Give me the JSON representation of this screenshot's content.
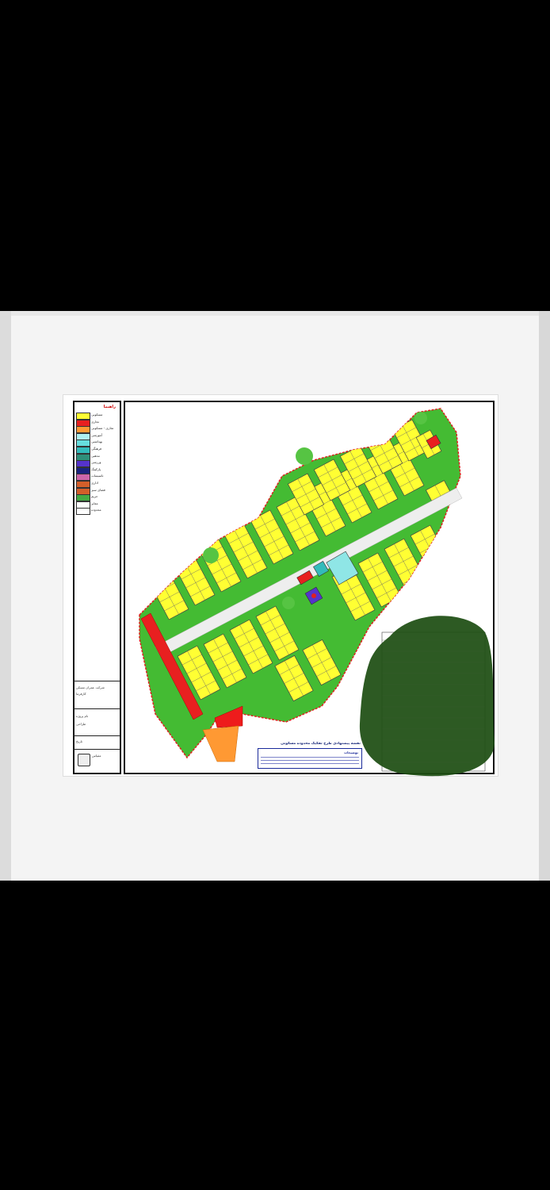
{
  "legend": {
    "title": "راهنما",
    "items": [
      {
        "label": "مسکونی",
        "color": "#ffff33"
      },
      {
        "label": "تجاری",
        "color": "#e82020"
      },
      {
        "label": "تجاری - مسکونی",
        "color": "#ff9933"
      },
      {
        "label": "آموزشی",
        "color": "#aef0f0"
      },
      {
        "label": "بهداشتی",
        "color": "#66dddd"
      },
      {
        "label": "فرهنگی",
        "color": "#33bbbb"
      },
      {
        "label": "مذهبی",
        "color": "#2f8f7a"
      },
      {
        "label": "ورزشی",
        "color": "#5533cc"
      },
      {
        "label": "پارکینگ",
        "color": "#1a237e"
      },
      {
        "label": "تاسیسات",
        "color": "#cc66aa"
      },
      {
        "label": "اداری",
        "color": "#d35f2a"
      },
      {
        "label": "فضای سبز",
        "color": "#d35f2a"
      },
      {
        "label": "حریم",
        "color": "#44aa44"
      },
      {
        "label": "معابر",
        "color": "#ffffff"
      },
      {
        "label": "محدوده",
        "color": "#ffffff"
      }
    ]
  },
  "info": {
    "company": "شرکت عمران مسکن",
    "client": "کارفرما",
    "project": "نام پروژه",
    "design": "طراحی",
    "date": "تاریخ",
    "scale": "مقیاس"
  },
  "map": {
    "title": "نقشه پیشنهادی طرح تفکیک محدوده مسکونی",
    "notes_title": "توضیحات"
  },
  "colors": {
    "residential": "#ffff33",
    "green": "#44bb33",
    "road": "#eeeeee",
    "boundary": "#e02020",
    "commercial": "#e82020",
    "orange": "#ff9933",
    "cyan": "#8fe6e6",
    "teal": "#33bbbb",
    "purple": "#5533cc",
    "blob": "#1d4d12"
  }
}
